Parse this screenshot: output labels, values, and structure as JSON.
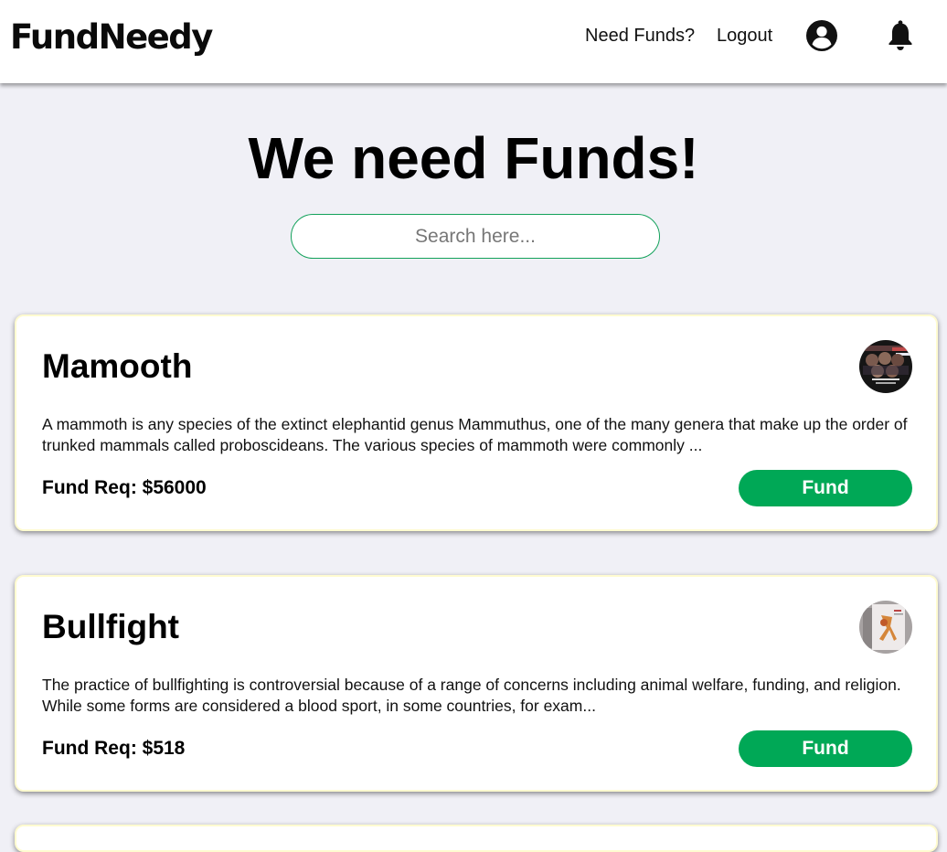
{
  "navbar": {
    "brand": "FundNeedy",
    "links": [
      {
        "label": "Need Funds?"
      },
      {
        "label": "Logout"
      }
    ],
    "icons": [
      "user-circle-icon",
      "bell-icon"
    ]
  },
  "hero": {
    "title": "We need Funds!"
  },
  "search": {
    "placeholder": "Search here...",
    "value": ""
  },
  "cards": [
    {
      "title": "Mamooth",
      "description": "A mammoth is any species of the extinct elephantid genus Mammuthus, one of the many genera that make up the order of trunked mammals called proboscideans. The various species of mammoth were commonly ...",
      "fund_req": "Fund Req: $56000",
      "button_label": "Fund",
      "avatar_icon": "avatar-image"
    },
    {
      "title": "Bullfight",
      "description": "The practice of bullfighting is controversial because of a range of concerns including animal welfare, funding, and religion. While some forms are considered a blood sport, in some countries, for exam...",
      "fund_req": "Fund Req: $518",
      "button_label": "Fund",
      "avatar_icon": "avatar-image"
    }
  ],
  "colors": {
    "page_background": "#f0f0f6",
    "accent_green": "#00a856",
    "search_border": "#12a15a",
    "card_border": "#fffbd0"
  }
}
